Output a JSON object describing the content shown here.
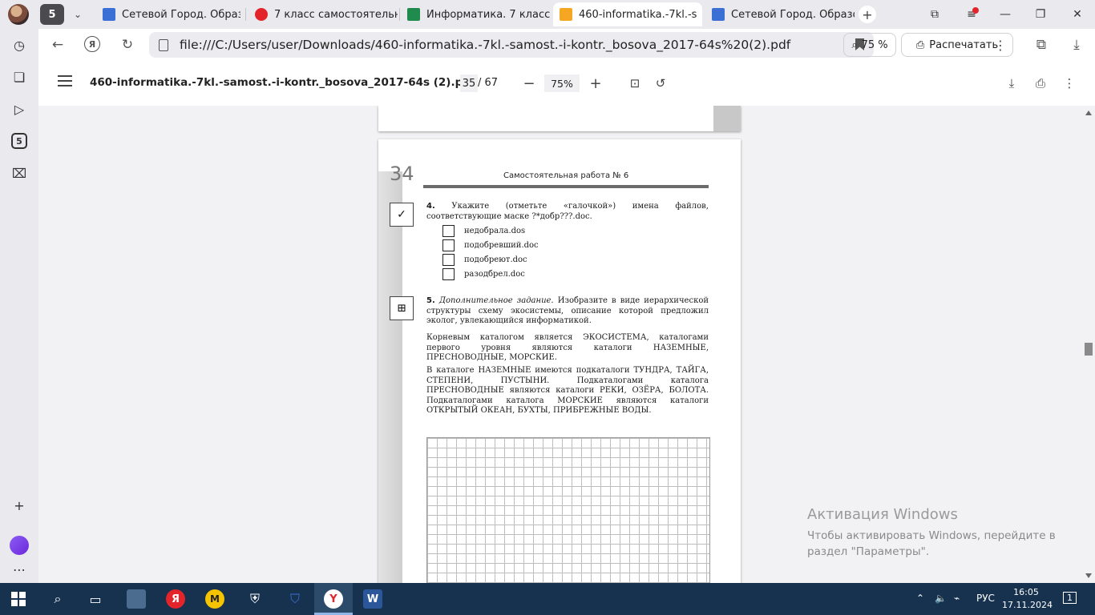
{
  "browser": {
    "tab_count": "5",
    "tabs": [
      {
        "title": "Сетевой Город. Образо",
        "favicon_color": "#3b6fd6"
      },
      {
        "title": "7 класс самостоятельны",
        "favicon_color": "#e3242b"
      },
      {
        "title": "Информатика. 7 класс. ",
        "favicon_color": "#1f8b4c"
      },
      {
        "title": "460-informatika.-7kl.-s",
        "favicon_color": "#f5a623",
        "active": true
      },
      {
        "title": "Сетевой Город. Образо",
        "favicon_color": "#3b6fd6"
      }
    ],
    "url": "file:///C:/Users/user/Downloads/460-informatika.-7kl.-samost.-i-kontr._bosova_2017-64s%20(2).pdf",
    "zoom": "75 %",
    "print_label": "Распечатать"
  },
  "pdf_toolbar": {
    "filename": "460-informatika.-7kl.-samost.-i-kontr._bosova_2017-64s (2).pdf",
    "current_page": "35",
    "total_pages": "/ 67",
    "zoom": "75%"
  },
  "page": {
    "number": "34",
    "header": "Самостоятельная работа № 6",
    "task4": {
      "num": "4.",
      "text": "Укажите (отметьте «галочкой») имена файлов, соответствующие маске ?*добр???.doc.",
      "options": [
        "недобрала.dos",
        "подобревший.doc",
        "подобреют.doc",
        "разодбрел.doc"
      ]
    },
    "task5": {
      "num": "5.",
      "lead": "Дополнительное задание.",
      "text": "Изобразите в виде иерархической структуры схему экосистемы, описание которой предложил эколог, увлекающийся информатикой.",
      "para1": "Корневым каталогом является ЭКОСИСТЕМА, каталогами первого уровня являются каталоги НАЗЕМНЫЕ, ПРЕСНОВОДНЫЕ, МОРСКИЕ.",
      "para2": "В каталоге НАЗЕМНЫЕ имеются подкаталоги ТУНДРА, ТАЙГА, СТЕПЕНИ, ПУСТЫНИ. Подкаталогами каталога ПРЕСНОВОДНЫЕ являются каталоги РЕКИ, ОЗЁРА, БОЛОТА. Подкаталогами каталога МОРСКИЕ являются каталоги ОТКРЫТЫЙ ОКЕАН, БУХТЫ, ПРИБРЕЖНЫЕ ВОДЫ."
    }
  },
  "activation": {
    "title": "Активация Windows",
    "text": "Чтобы активировать Windows, перейдите в раздел \"Параметры\"."
  },
  "taskbar": {
    "language": "РУС",
    "time": "16:05",
    "date": "17.11.2024",
    "notifications": "1"
  }
}
